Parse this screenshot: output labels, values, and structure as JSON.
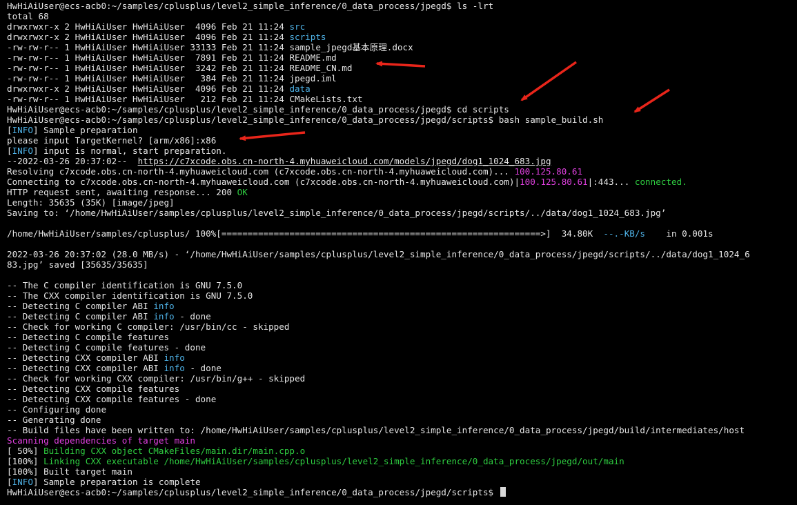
{
  "terminal": {
    "prompt1": "HwHiAiUser@ecs-acb0:~/samples/cplusplus/level2_simple_inference/0_data_process/jpegd$ ls -lrt",
    "total": "total 68",
    "ls": [
      {
        "meta": "drwxrwxr-x 2 HwHiAiUser HwHiAiUser  4096 Feb 21 11:24 ",
        "name": "src",
        "type": "dir"
      },
      {
        "meta": "drwxrwxr-x 2 HwHiAiUser HwHiAiUser  4096 Feb 21 11:24 ",
        "name": "scripts",
        "type": "dir"
      },
      {
        "meta": "-rw-rw-r-- 1 HwHiAiUser HwHiAiUser 33133 Feb 21 11:24 ",
        "name": "sample_jpegd基本原理.docx",
        "type": "file"
      },
      {
        "meta": "-rw-rw-r-- 1 HwHiAiUser HwHiAiUser  7891 Feb 21 11:24 ",
        "name": "README.md",
        "type": "file"
      },
      {
        "meta": "-rw-rw-r-- 1 HwHiAiUser HwHiAiUser  3242 Feb 21 11:24 ",
        "name": "README_CN.md",
        "type": "file"
      },
      {
        "meta": "-rw-rw-r-- 1 HwHiAiUser HwHiAiUser   384 Feb 21 11:24 ",
        "name": "jpegd.iml",
        "type": "file"
      },
      {
        "meta": "drwxrwxr-x 2 HwHiAiUser HwHiAiUser  4096 Feb 21 11:24 ",
        "name": "data",
        "type": "dir"
      },
      {
        "meta": "-rw-rw-r-- 1 HwHiAiUser HwHiAiUser   212 Feb 21 11:24 ",
        "name": "CMakeLists.txt",
        "type": "file"
      }
    ],
    "prompt2": "HwHiAiUser@ecs-acb0:~/samples/cplusplus/level2_simple_inference/0_data_process/jpegd$ cd scripts",
    "prompt3": "HwHiAiUser@ecs-acb0:~/samples/cplusplus/level2_simple_inference/0_data_process/jpegd/scripts$ bash sample_build.sh",
    "info_tag": "INFO",
    "info1": "] Sample preparation",
    "target_prompt": "please input TargetKernel? [arm/x86]:x86",
    "info2": "] input is normal, start preparation.",
    "wget_time": "--2022-03-26 20:37:02--  ",
    "wget_url": "https://c7xcode.obs.cn-north-4.myhuaweicloud.com/models/jpegd/dog1_1024_683.jpg",
    "resolving_prefix": "Resolving c7xcode.obs.cn-north-4.myhuaweicloud.com (c7xcode.obs.cn-north-4.myhuaweicloud.com)... ",
    "ip": "100.125.80.61",
    "connecting_prefix": "Connecting to c7xcode.obs.cn-north-4.myhuaweicloud.com (c7xcode.obs.cn-north-4.myhuaweicloud.com)|",
    "connecting_mid": "|:443... ",
    "connected": "connected.",
    "http_prefix": "HTTP request sent, awaiting response... 200 ",
    "http_ok": "OK",
    "length": "Length: 35635 (35K) [image/jpeg]",
    "saving": "Saving to: ‘/home/HwHiAiUser/samples/cplusplus/level2_simple_inference/0_data_process/jpegd/scripts/../data/dog1_1024_683.jpg’",
    "progress_prefix": "/home/HwHiAiUser/samples/cplusplus/ 100%[=============================================================>]  34.80K  ",
    "progress_speed": "--.-KB/s",
    "progress_suffix": "    in 0.001s",
    "saved1": "2022-03-26 20:37:02 (28.0 MB/s) - ‘/home/HwHiAiUser/samples/cplusplus/level2_simple_inference/0_data_process/jpegd/scripts/../data/dog1_1024_6",
    "saved2": "83.jpg’ saved [35635/35635]",
    "cmake": [
      {
        "pre": "-- The C compiler identification is GNU 7.5.0",
        "hl": "",
        "post": ""
      },
      {
        "pre": "-- The CXX compiler identification is GNU 7.5.0",
        "hl": "",
        "post": ""
      },
      {
        "pre": "-- Detecting C compiler ABI ",
        "hl": "info",
        "post": ""
      },
      {
        "pre": "-- Detecting C compiler ABI ",
        "hl": "info",
        "post": " - done"
      },
      {
        "pre": "-- Check for working C compiler: /usr/bin/cc - skipped",
        "hl": "",
        "post": ""
      },
      {
        "pre": "-- Detecting C compile features",
        "hl": "",
        "post": ""
      },
      {
        "pre": "-- Detecting C compile features - done",
        "hl": "",
        "post": ""
      },
      {
        "pre": "-- Detecting CXX compiler ABI ",
        "hl": "info",
        "post": ""
      },
      {
        "pre": "-- Detecting CXX compiler ABI ",
        "hl": "info",
        "post": " - done"
      },
      {
        "pre": "-- Check for working CXX compiler: /usr/bin/g++ - skipped",
        "hl": "",
        "post": ""
      },
      {
        "pre": "-- Detecting CXX compile features",
        "hl": "",
        "post": ""
      },
      {
        "pre": "-- Detecting CXX compile features - done",
        "hl": "",
        "post": ""
      },
      {
        "pre": "-- Configuring done",
        "hl": "",
        "post": ""
      },
      {
        "pre": "-- Generating done",
        "hl": "",
        "post": ""
      },
      {
        "pre": "-- Build files have been written to: /home/HwHiAiUser/samples/cplusplus/level2_simple_inference/0_data_process/jpegd/build/intermediates/host",
        "hl": "",
        "post": ""
      }
    ],
    "scanning": "Scanning dependencies of target main",
    "build50_pct": "[ 50%] ",
    "build50_msg": "Building CXX object CMakeFiles/main.dir/main.cpp.o",
    "link_pct": "[100%] ",
    "link_msg": "Linking CXX executable /home/HwHiAiUser/samples/cplusplus/level2_simple_inference/0_data_process/jpegd/out/main",
    "built": "[100%] Built target main",
    "info3": "] Sample preparation is complete",
    "prompt_final": "HwHiAiUser@ecs-acb0:~/samples/cplusplus/level2_simple_inference/0_data_process/jpegd/scripts$ "
  },
  "colors": {
    "background": "#000000",
    "text": "#e6e6e6",
    "directory": "#4fb3e8",
    "ip": "#e040e0",
    "success": "#2ecc40",
    "arrow": "#e8251a"
  }
}
